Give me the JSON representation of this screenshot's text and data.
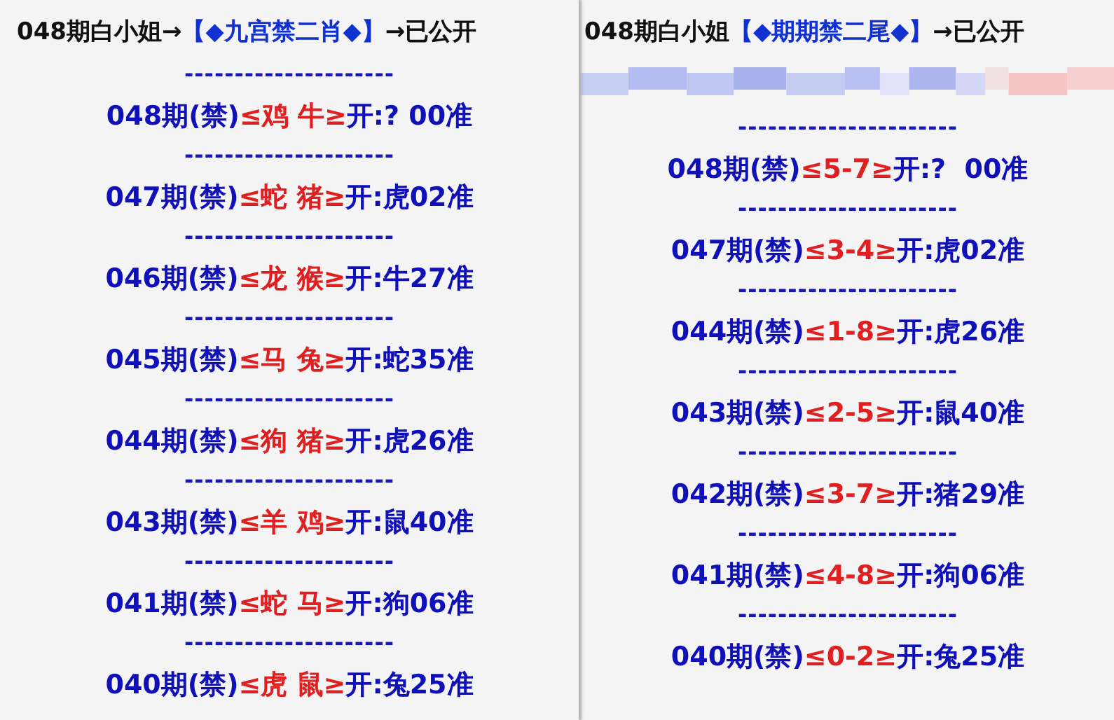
{
  "panels": [
    {
      "header": {
        "prefix": "048期白小姐→",
        "highlight": "【◆九宫禁二肖◆】",
        "suffix": "→已公开"
      },
      "blurred_strip": false,
      "entries": [
        {
          "separator": "---------------------",
          "period": "048期(禁)",
          "forbidden": "≤鸡 牛≥",
          "result": "开:? 00准"
        },
        {
          "separator": "---------------------",
          "period": "047期(禁)",
          "forbidden": "≤蛇 猪≥",
          "result": "开:虎02准"
        },
        {
          "separator": "---------------------",
          "period": "046期(禁)",
          "forbidden": "≤龙 猴≥",
          "result": "开:牛27准"
        },
        {
          "separator": "---------------------",
          "period": "045期(禁)",
          "forbidden": "≤马 兔≥",
          "result": "开:蛇35准"
        },
        {
          "separator": "---------------------",
          "period": "044期(禁)",
          "forbidden": "≤狗 猪≥",
          "result": "开:虎26准"
        },
        {
          "separator": "---------------------",
          "period": "043期(禁)",
          "forbidden": "≤羊 鸡≥",
          "result": "开:鼠40准"
        },
        {
          "separator": "---------------------",
          "period": "041期(禁)",
          "forbidden": "≤蛇 马≥",
          "result": "开:狗06准"
        },
        {
          "separator": "---------------------",
          "period": "040期(禁)",
          "forbidden": "≤虎 鼠≥",
          "result": "开:兔25准"
        }
      ]
    },
    {
      "header": {
        "prefix": "048期白小姐",
        "highlight": "【◆期期禁二尾◆】",
        "suffix": "→已公开"
      },
      "blurred_strip": true,
      "entries": [
        {
          "separator": "----------------------",
          "period": "048期(禁)",
          "forbidden": "≤5-7≥",
          "result": "开:?  00准"
        },
        {
          "separator": "----------------------",
          "period": "047期(禁)",
          "forbidden": "≤3-4≥",
          "result": "开:虎02准"
        },
        {
          "separator": "----------------------",
          "period": "044期(禁)",
          "forbidden": "≤1-8≥",
          "result": "开:虎26准"
        },
        {
          "separator": "----------------------",
          "period": "043期(禁)",
          "forbidden": "≤2-5≥",
          "result": "开:鼠40准"
        },
        {
          "separator": "----------------------",
          "period": "042期(禁)",
          "forbidden": "≤3-7≥",
          "result": "开:猪29准"
        },
        {
          "separator": "----------------------",
          "period": "041期(禁)",
          "forbidden": "≤4-8≥",
          "result": "开:狗06准"
        },
        {
          "separator": "----------------------",
          "period": "040期(禁)",
          "forbidden": "≤0-2≥",
          "result": "开:兔25准"
        }
      ]
    }
  ]
}
